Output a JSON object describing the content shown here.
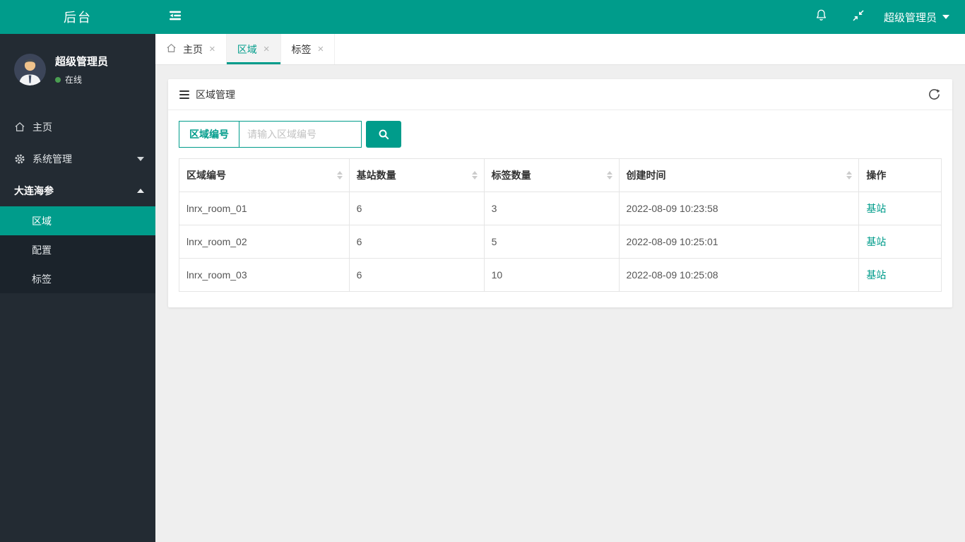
{
  "colors": {
    "accent": "#009c8b",
    "sidebar_bg": "#232b33",
    "submenu_bg": "#1b232b",
    "content_bg": "#efefef",
    "online_green": "#4a9e51"
  },
  "topbar": {
    "brand": "后台",
    "user_label": "超级管理员",
    "icons": {
      "toggle": "menu-toggle-icon",
      "bell": "bell-icon",
      "fullscreen_exit": "fullscreen-exit-icon",
      "caret": "caret-down-icon"
    }
  },
  "sidebar": {
    "user": {
      "name": "超级管理员",
      "status": "在线"
    },
    "menu": [
      {
        "label": "主页",
        "icon": "home-icon"
      },
      {
        "label": "系统管理",
        "icon": "gear-icon",
        "caret": "down"
      },
      {
        "label": "大连海参",
        "caret": "up"
      }
    ],
    "submenu": [
      {
        "label": "区域",
        "active": true
      },
      {
        "label": "配置",
        "active": false
      },
      {
        "label": "标签",
        "active": false
      }
    ]
  },
  "tabs": [
    {
      "label": "主页",
      "icon": "home-icon",
      "active": false
    },
    {
      "label": "区域",
      "active": true
    },
    {
      "label": "标签",
      "active": false
    }
  ],
  "panel": {
    "title": "区域管理",
    "search": {
      "field_label": "区域编号",
      "placeholder": "请输入区域编号"
    }
  },
  "table": {
    "columns": [
      {
        "label": "区域编号",
        "sortable": true
      },
      {
        "label": "基站数量",
        "sortable": true
      },
      {
        "label": "标签数量",
        "sortable": true
      },
      {
        "label": "创建时间",
        "sortable": true
      },
      {
        "label": "操作",
        "sortable": false
      }
    ],
    "rows": [
      {
        "region_id": "lnrx_room_01",
        "base_station_count": "6",
        "tag_count": "3",
        "created_at": "2022-08-09 10:23:58",
        "action": "基站"
      },
      {
        "region_id": "lnrx_room_02",
        "base_station_count": "6",
        "tag_count": "5",
        "created_at": "2022-08-09 10:25:01",
        "action": "基站"
      },
      {
        "region_id": "lnrx_room_03",
        "base_station_count": "6",
        "tag_count": "10",
        "created_at": "2022-08-09 10:25:08",
        "action": "基站"
      }
    ]
  },
  "glyphs": {
    "close": "×"
  }
}
